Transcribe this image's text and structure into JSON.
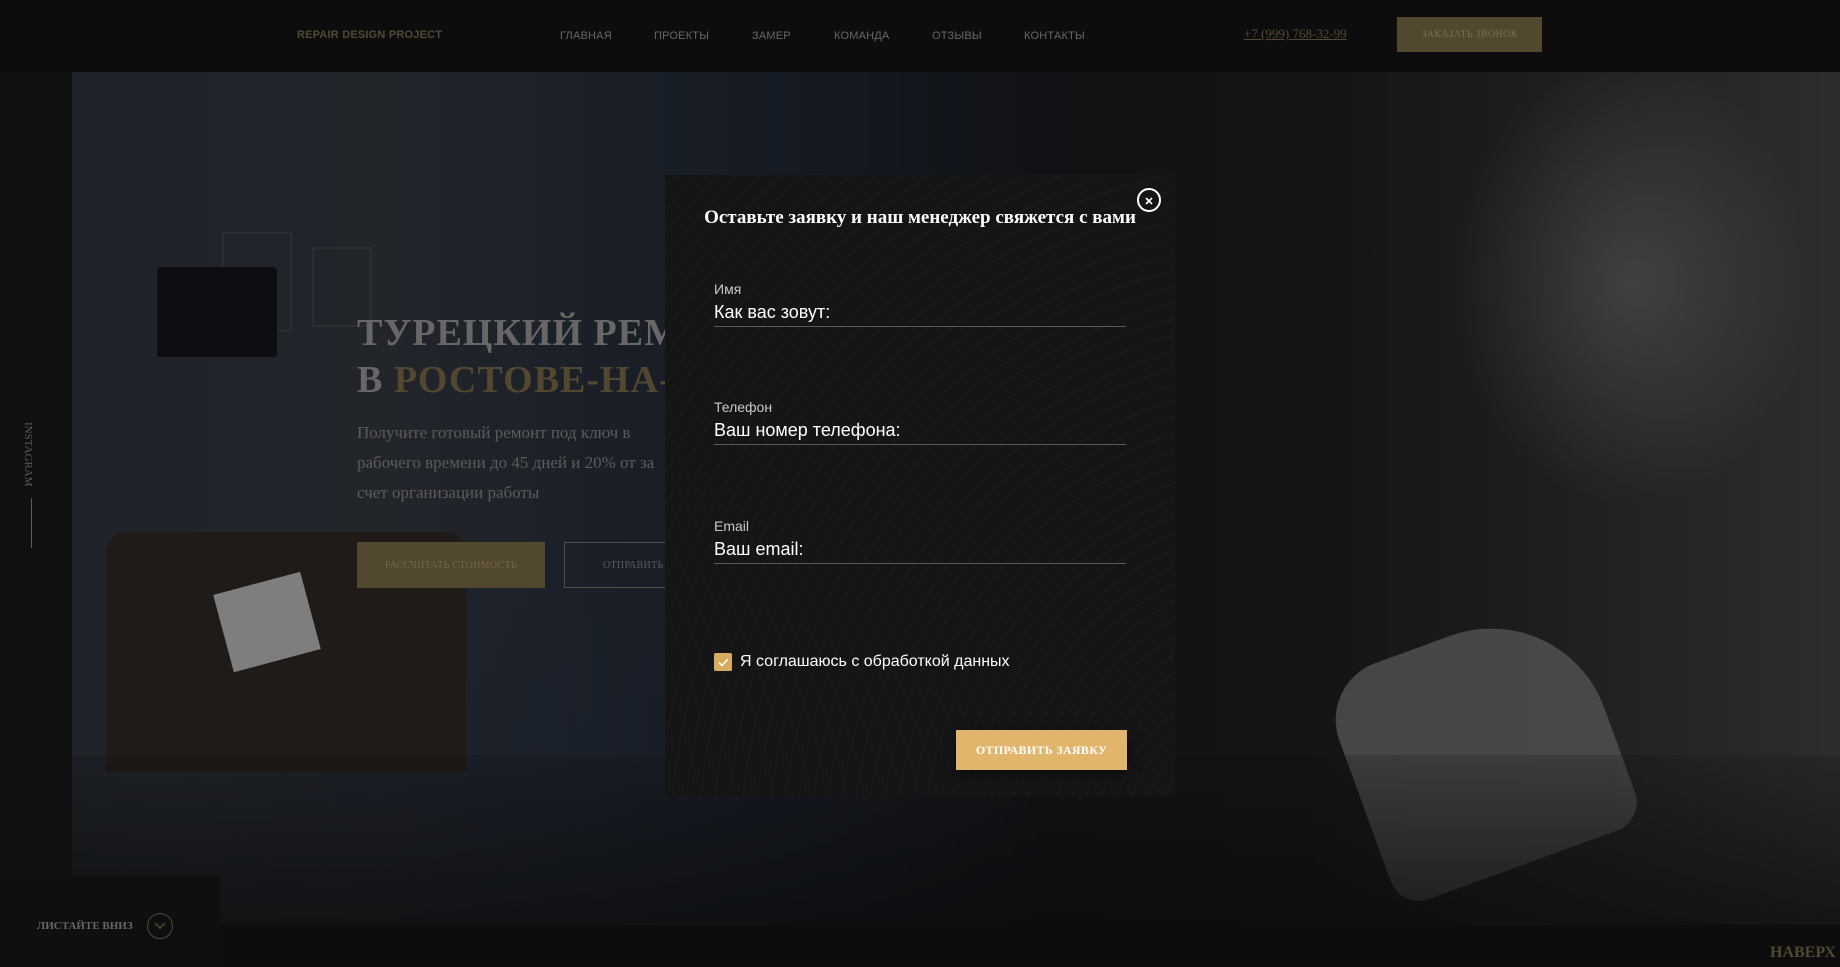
{
  "header": {
    "logo": "REPAIR DESIGN PROJECT",
    "nav": [
      {
        "label": "ГЛАВНАЯ"
      },
      {
        "label": "ПРОЕКТЫ"
      },
      {
        "label": "ЗАМЕР"
      },
      {
        "label": "КОМАНДА"
      },
      {
        "label": "ОТЗЫВЫ"
      },
      {
        "label": "КОНТАКТЫ"
      }
    ],
    "phone": "+7 (999) 768-32-99",
    "call_button": "ЗАКАЗАТЬ ЗВОНОК"
  },
  "hero": {
    "title_line1": "ТУРЕЦКИЙ РЕМ",
    "title_line2_prefix": "В ",
    "title_line2_accent": "РОСТОВЕ-НА-Д",
    "description": "Получите готовый ремонт под ключ в рабочего времени до 45 дней и 20% от за счет организации работы",
    "calc_button": "РАССЧИТАТЬ СТОИМОСТЬ",
    "send_button": "ОТПРАВИТЬ"
  },
  "side": {
    "instagram": "INSTAGRAM",
    "scroll_down": "ЛИСТАЙТЕ ВНИЗ",
    "to_top": "НАВЕРХ"
  },
  "modal": {
    "title": "Оставьте заявку и наш менеджер свяжется с вами",
    "fields": [
      {
        "label": "Имя",
        "placeholder": "Как вас зовут:"
      },
      {
        "label": "Телефон",
        "placeholder": "Ваш номер телефона:"
      },
      {
        "label": "Email",
        "placeholder": "Ваш email:"
      }
    ],
    "consent": "Я соглашаюсь с обработкой данных",
    "consent_checked": true,
    "submit": "ОТПРАВИТЬ ЗАЯВКУ"
  },
  "colors": {
    "accent": "#e2b56c",
    "checkbox": "#d8aa5d",
    "background": "#151515"
  }
}
